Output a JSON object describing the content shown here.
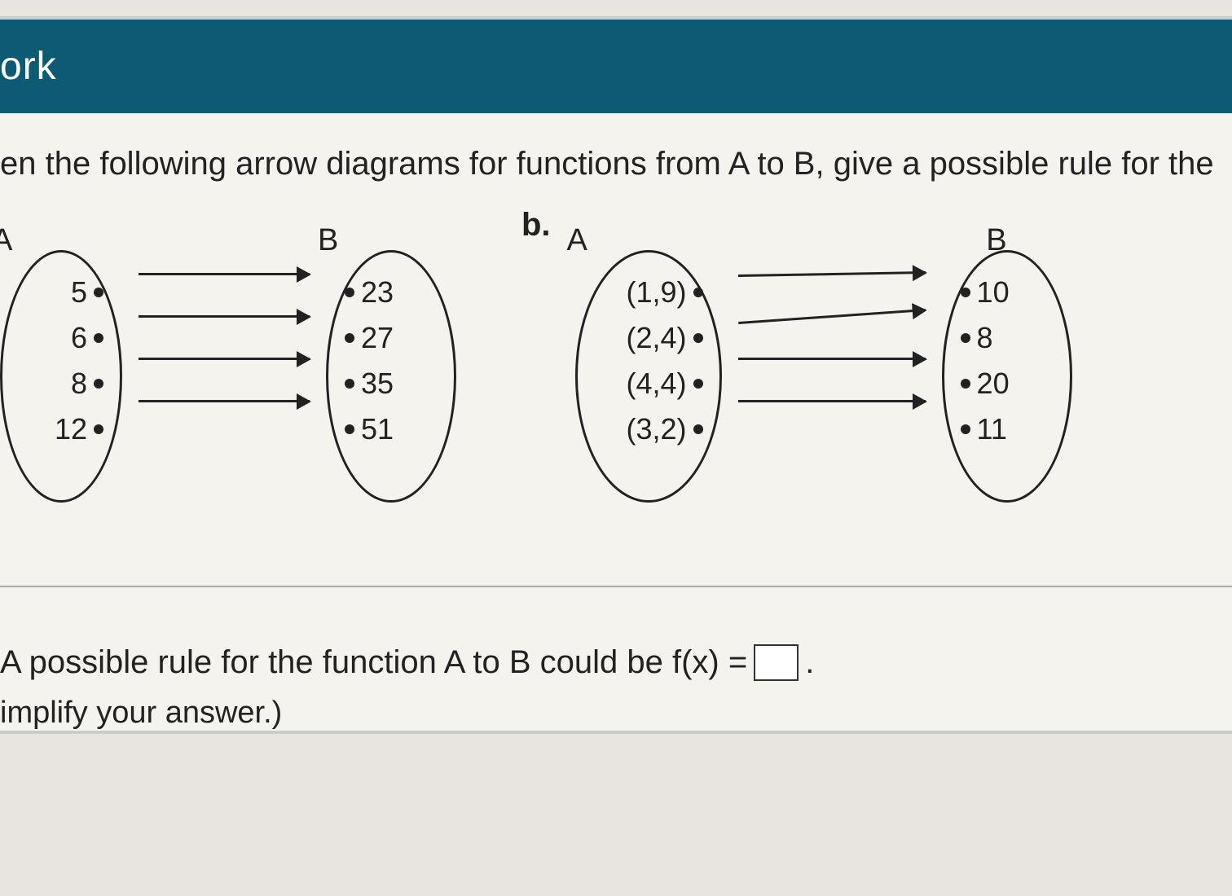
{
  "header": {
    "title_fragment": "ork"
  },
  "instruction": "en the following arrow diagrams for functions from A to B, give a possible rule for the",
  "diagrams": {
    "a": {
      "labelA": "A",
      "labelB": "B",
      "domain": [
        "5",
        "6",
        "8",
        "12"
      ],
      "range": [
        "23",
        "27",
        "35",
        "51"
      ]
    },
    "b": {
      "part": "b.",
      "labelA": "A",
      "labelB": "B",
      "domain": [
        "(1,9)",
        "(2,4)",
        "(4,4)",
        "(3,2)"
      ],
      "range": [
        "10",
        "8",
        "20",
        "11"
      ]
    }
  },
  "answer": {
    "prefix": "A possible rule for the function A to B could be f(x) =",
    "suffix": ".",
    "hint": "implify your answer.)"
  }
}
